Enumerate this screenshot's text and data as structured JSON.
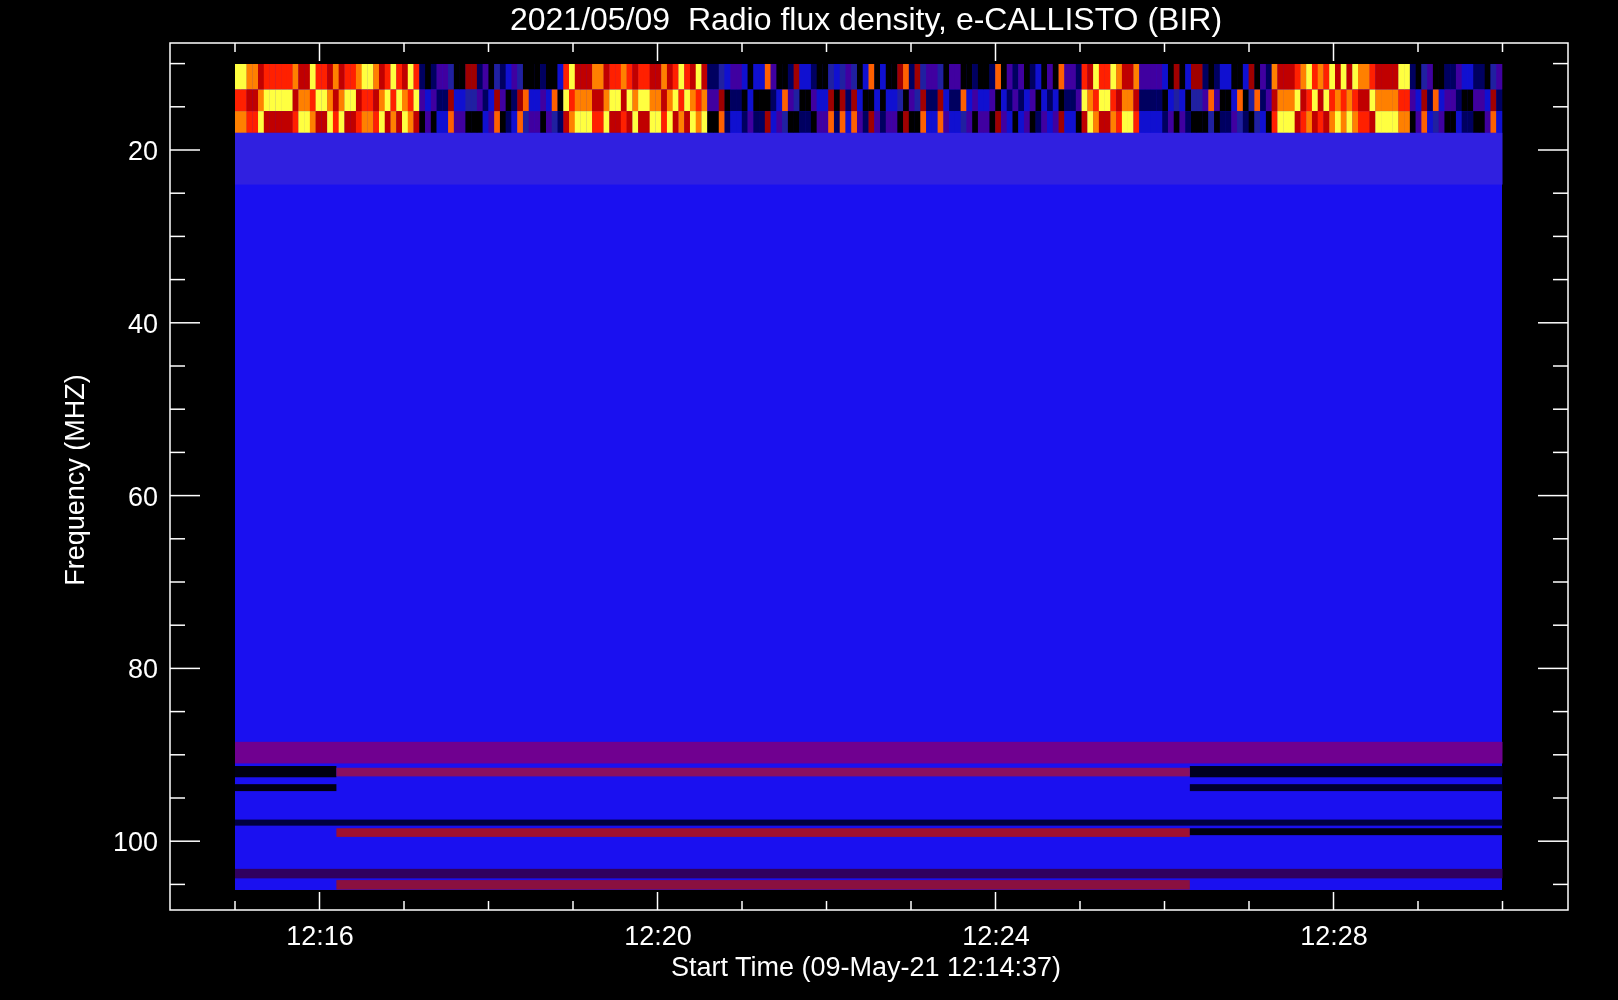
{
  "chart": {
    "title": "2021/05/09  Radio flux density, e-CALLISTO (BIR)",
    "xlabel": "Start Time (09-May-21 12:14:37)",
    "ylabel": "Frequency (MHZ)",
    "xticks": [
      "12:16",
      "12:20",
      "12:24",
      "12:28"
    ],
    "yticks": [
      "20",
      "40",
      "60",
      "80",
      "100"
    ]
  }
}
